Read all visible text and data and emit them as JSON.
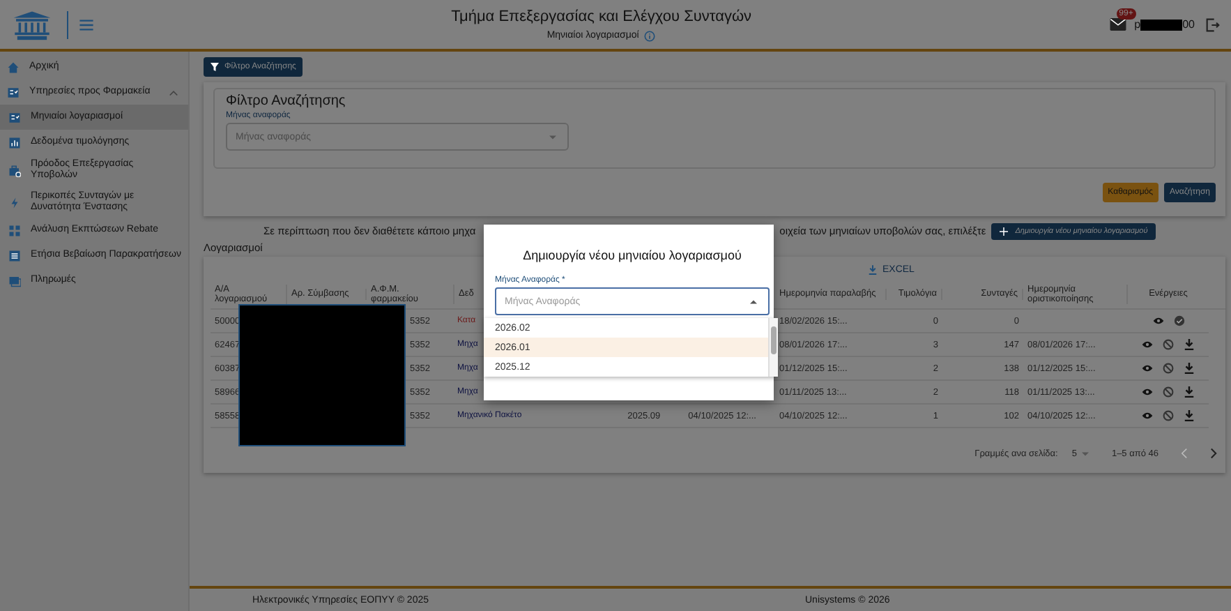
{
  "header": {
    "title": "Τμήμα Επεξεργασίας και Ελέγχου Συνταγών",
    "subtitle": "Μηνιαίοι λογαριασμοί",
    "badge": "99+",
    "user_prefix": "p",
    "user_suffix": "00"
  },
  "sidebar": {
    "items": [
      {
        "label": "Αρχική",
        "selected": false
      },
      {
        "label": "Υπηρεσίες προς Φαρμακεία",
        "selected": false,
        "expanded": true,
        "children": [
          {
            "label": "Μηνιαίοι λογαριασμοί",
            "selected": true
          },
          {
            "label": "Δεδομένα τιμολόγησης",
            "selected": false
          },
          {
            "label": "Πρόοδος Επεξεργασίας Υποβολών",
            "selected": false
          },
          {
            "label": "Περικοπές Συνταγών με Δυνατότητα Ένστασης",
            "selected": false
          },
          {
            "label": "Ανάλυση Εκπτώσεων Rebate",
            "selected": false
          },
          {
            "label": "Ετήσια Βεβαίωση Παρακρατήσεων",
            "selected": false
          },
          {
            "label": "Πληρωμές",
            "selected": false
          }
        ]
      }
    ]
  },
  "filter": {
    "toggle_button": "Φίλτρο Αναζήτησης",
    "legend": "Φίλτρο Αναζήτησης",
    "field_label": "Μήνας αναφοράς",
    "placeholder": "Μήνας αναφοράς",
    "buttons": [
      {
        "label": "Καθαρισμός",
        "kind": "clear"
      },
      {
        "label": "Αναζήτηση",
        "kind": "search"
      }
    ]
  },
  "notice": {
    "text_before": "Σε περίπτωση που δεν διαθέτετε κάποιο μηχα",
    "text_after": "οιχεία των μηνιαίων υποβολών σας, επιλέξτε",
    "button": "Δημιουργία νέου μηνιαίου λογαριασμού"
  },
  "table": {
    "title": "Λογαριασμοί",
    "export": "EXCEL",
    "columns": [
      "Α/Α λογαριασμού",
      "Αρ. Σύμβασης",
      "Α.Φ.Μ. φαρμακείου",
      "Δεδ",
      "Ημερομηνία παραλαβής",
      "Τιμολόγια",
      "Συνταγές",
      "Ημερομηνία οριστικοποίησης",
      "Ενέργειες"
    ],
    "rows": [
      {
        "id": "50000",
        "afm": "5352",
        "type": "Κατα",
        "color": "#6b1717",
        "received": "18/02/2026 15:...",
        "invoices": "0",
        "prescriptions": "0",
        "actions": [
          {
            "kind": "view"
          },
          {
            "kind": "approve"
          }
        ]
      },
      {
        "id": "62467",
        "afm": "5352",
        "type": "Μηχα",
        "color": "#0d1140",
        "received": "08/01/2026 17:...",
        "invoices": "3",
        "prescriptions": "147",
        "finalized": "08/01/2026 17:...",
        "actions": [
          {
            "kind": "view"
          },
          {
            "kind": "blocked"
          },
          {
            "kind": "download"
          }
        ]
      },
      {
        "id": "60387",
        "afm": "5352",
        "type": "Μηχα",
        "color": "#0d1140",
        "received": "01/12/2025 15:...",
        "invoices": "2",
        "prescriptions": "138",
        "finalized": "01/12/2025 15:...",
        "actions": [
          {
            "kind": "view"
          },
          {
            "kind": "blocked"
          },
          {
            "kind": "download"
          }
        ]
      },
      {
        "id": "58966",
        "afm": "5352",
        "type": "Μηχα",
        "color": "#0d1140",
        "received": "01/11/2025 13:...",
        "invoices": "2",
        "prescriptions": "118",
        "finalized": "01/11/2025 13:...",
        "actions": [
          {
            "kind": "view"
          },
          {
            "kind": "blocked"
          },
          {
            "kind": "download"
          }
        ]
      },
      {
        "id": "58558",
        "afm": "5352",
        "type": "Μηχανικό Πακέτο",
        "color": "#0d1140",
        "month": "2025.09",
        "submitted": "04/10/2025 12:...",
        "received": "04/10/2025 12:...",
        "invoices": "1",
        "prescriptions": "102",
        "finalized": "04/10/2025 12:...",
        "actions": [
          {
            "kind": "view"
          },
          {
            "kind": "blocked"
          },
          {
            "kind": "download"
          }
        ]
      }
    ],
    "pagination": {
      "rows_per_page_label": "Γραμμές ανα σελίδα:",
      "rows_per_page": "5",
      "range": "1–5 από 46"
    }
  },
  "modal": {
    "title": "Δημιουργία νέου μηνιαίου λογαριασμού",
    "field_label": "Μήνας Αναφοράς *",
    "placeholder": "Μήνας Αναφοράς",
    "options": [
      {
        "label": "2026.02",
        "highlighted": false
      },
      {
        "label": "2026.01",
        "highlighted": true
      },
      {
        "label": "2025.12",
        "highlighted": false
      }
    ]
  },
  "footer": {
    "left": "Ηλεκτρονικές Υπηρεσίες ΕΟΠΥΥ © 2025",
    "right": "Unisystems © 2026"
  }
}
